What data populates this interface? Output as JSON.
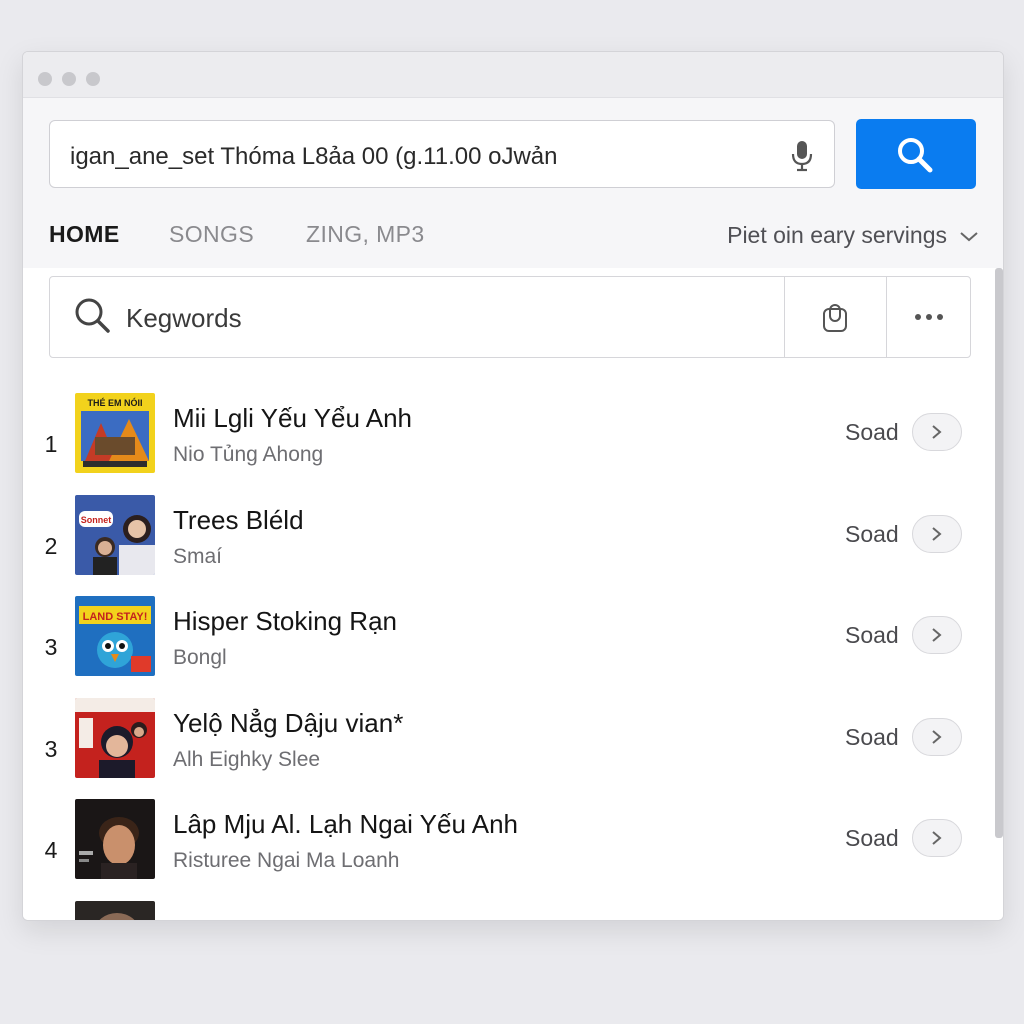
{
  "browser": {
    "url_value": "igan_ane_set Thóma L8ảa 00 (g.11.00 oJwản",
    "mic_icon": "microphone-icon",
    "search_icon": "search-icon",
    "accent_color": "#0a7cf0"
  },
  "tabs": [
    {
      "label": "HOME",
      "active": true
    },
    {
      "label": "SONGS",
      "active": false
    },
    {
      "label": "ZING, MP3",
      "active": false
    }
  ],
  "account_menu": {
    "label": "Piet oin eary servings",
    "icon": "chevron-down-icon"
  },
  "keyword_search": {
    "placeholder": "Kegwords",
    "icon": "search-icon",
    "share_icon": "clipboard-icon",
    "more_icon": "more-horizontal-icon"
  },
  "songs": [
    {
      "rank": "1",
      "title": "Mii Lgli Yếu Yểu Anh",
      "artist": "Nio Tủng Ahong",
      "action": "Soad"
    },
    {
      "rank": "2",
      "title": "Trees Bléld",
      "artist": "Smaí",
      "action": "Soad"
    },
    {
      "rank": "3",
      "title": "Hisper Stoking Rạn",
      "artist": "Bongl",
      "action": "Soad"
    },
    {
      "rank": "3",
      "title": "Yelộ Nẳg Dậju vian*",
      "artist": "Alh Eighky Slee",
      "action": "Soad"
    },
    {
      "rank": "4",
      "title": "Lâp Mju Al. Lạh Ngai Yếu Anh",
      "artist": "Risturee Ngai Ma Loanh",
      "action": "Soad"
    }
  ],
  "covers": [
    {
      "text": "THÉ EM NÓII",
      "bg": "#f2d21c"
    },
    {
      "text": "Sonnet",
      "bg": "#3a5aa8"
    },
    {
      "text": "LAND STAY!",
      "bg": "#1f6fc0"
    },
    {
      "text": "",
      "bg": "#c4221e"
    },
    {
      "text": "",
      "bg": "#1a1616"
    }
  ]
}
